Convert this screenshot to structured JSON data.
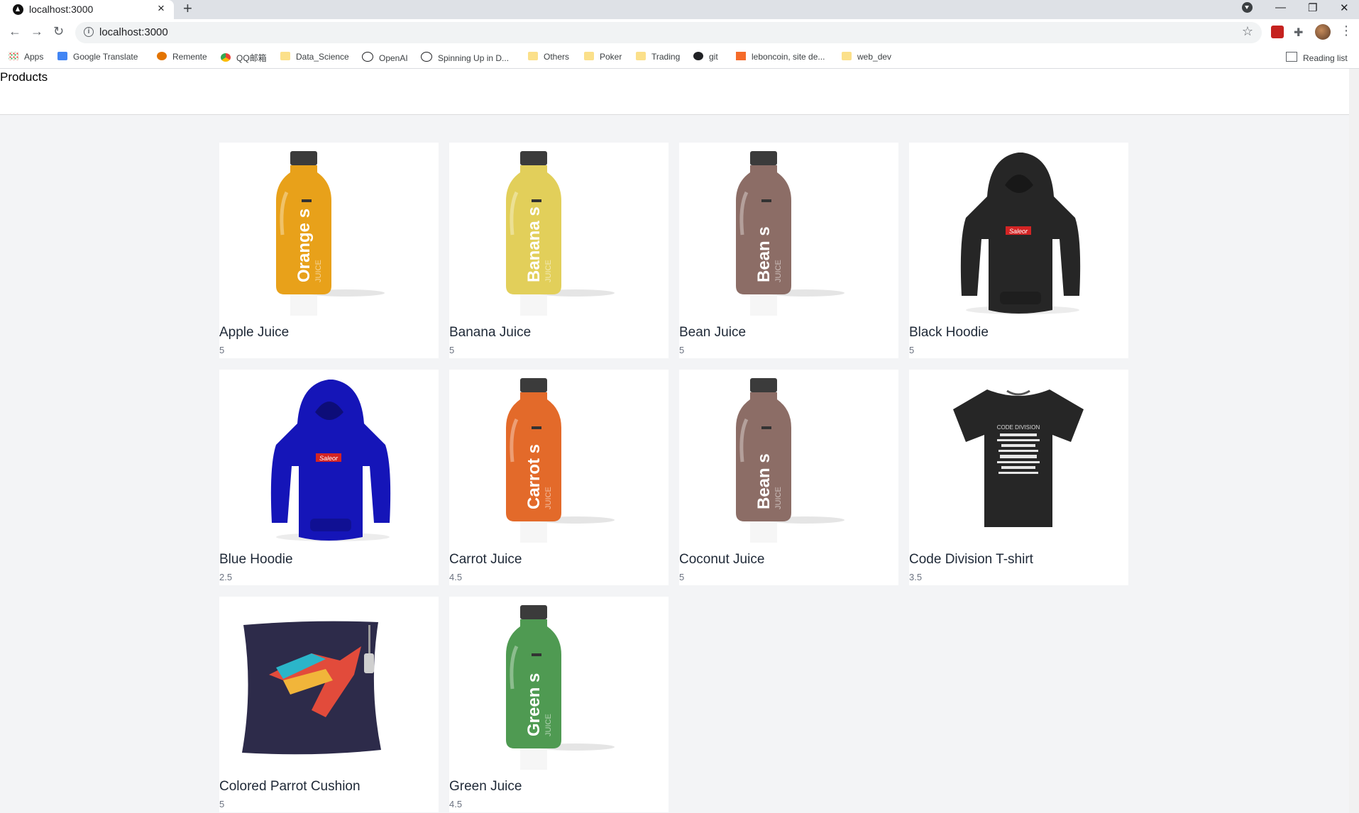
{
  "browser": {
    "tab_title": "localhost:3000",
    "url": "localhost:3000",
    "reading_list_label": "Reading list",
    "bookmarks": [
      {
        "label": "Apps",
        "icon": "apps-icon"
      },
      {
        "label": "Google Translate",
        "icon": "google-translate-icon"
      },
      {
        "label": "Remente",
        "icon": "remente-icon"
      },
      {
        "label": "QQ邮箱",
        "icon": "qq-mail-icon"
      },
      {
        "label": "Data_Science",
        "icon": "folder-icon"
      },
      {
        "label": "OpenAI",
        "icon": "openai-icon"
      },
      {
        "label": "Spinning Up in D...",
        "icon": "openai-icon"
      },
      {
        "label": "Others",
        "icon": "folder-icon"
      },
      {
        "label": "Poker",
        "icon": "folder-icon"
      },
      {
        "label": "Trading",
        "icon": "folder-icon"
      },
      {
        "label": "git",
        "icon": "github-icon"
      },
      {
        "label": "leboncoin, site de...",
        "icon": "leboncoin-icon"
      },
      {
        "label": "web_dev",
        "icon": "folder-icon"
      }
    ]
  },
  "page": {
    "title": "Products"
  },
  "products": [
    {
      "name": "Apple Juice",
      "rating": "5",
      "image": "bottle",
      "color": "#e8a11a",
      "label": "Orange"
    },
    {
      "name": "Banana Juice",
      "rating": "5",
      "image": "bottle",
      "color": "#e2cf5a",
      "label": "Banana"
    },
    {
      "name": "Bean Juice",
      "rating": "5",
      "image": "bottle",
      "color": "#8c6d66",
      "label": "Bean"
    },
    {
      "name": "Black Hoodie",
      "rating": "5",
      "image": "hoodie",
      "color": "#262626",
      "label": "Saleor"
    },
    {
      "name": "Blue Hoodie",
      "rating": "2.5",
      "image": "hoodie",
      "color": "#1515b8",
      "label": "Saleor"
    },
    {
      "name": "Carrot Juice",
      "rating": "4.5",
      "image": "bottle",
      "color": "#e36a2a",
      "label": "Carrot"
    },
    {
      "name": "Coconut Juice",
      "rating": "5",
      "image": "bottle",
      "color": "#8c6d66",
      "label": "Bean"
    },
    {
      "name": "Code Division T-shirt",
      "rating": "3.5",
      "image": "tshirt",
      "color": "#262626",
      "label": "CODE DIVISION"
    },
    {
      "name": "Colored Parrot Cushion",
      "rating": "5",
      "image": "cushion",
      "color": "#2d2b4a",
      "label": ""
    },
    {
      "name": "Green Juice",
      "rating": "4.5",
      "image": "bottle",
      "color": "#4f9a52",
      "label": "Green"
    }
  ]
}
